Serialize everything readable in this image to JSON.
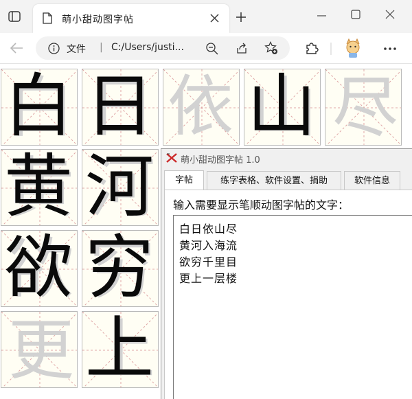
{
  "browser": {
    "tab_title": "萌小甜动图字帖",
    "address_label": "文件",
    "address_url": "C:/Users/justi...",
    "icons": [
      "tab-actions-icon",
      "page-icon",
      "close-icon",
      "new-tab-icon",
      "minimize-icon",
      "maximize-icon",
      "window-close-icon",
      "back-icon",
      "info-icon",
      "zoom-out-icon",
      "share-icon",
      "add-favorite-icon",
      "extensions-icon",
      "profile-avatar-icon",
      "more-icon"
    ]
  },
  "characters": [
    [
      "白",
      "日",
      "依",
      "山",
      "尽"
    ],
    [
      "黄",
      "河"
    ],
    [
      "欲",
      "穷"
    ],
    [
      "更",
      "上"
    ]
  ],
  "app": {
    "title": "萌小甜动图字帖 1.0",
    "tabs": [
      "字帖",
      "练字表格、软件设置、捐助",
      "软件信息"
    ],
    "prompt": "输入需要显示笔顺动图字帖的文字：",
    "lines": [
      "白日依山尽",
      "黄河入海流",
      "欲穷千里目",
      "更上一层楼"
    ]
  },
  "colors": {
    "grid_line": "#e0a8a8",
    "cell_background": "#fffef4",
    "ghost_glyph": "#d2d2d2",
    "glyph": "#0a0a0a",
    "app_icon": "#cc2a2a"
  }
}
